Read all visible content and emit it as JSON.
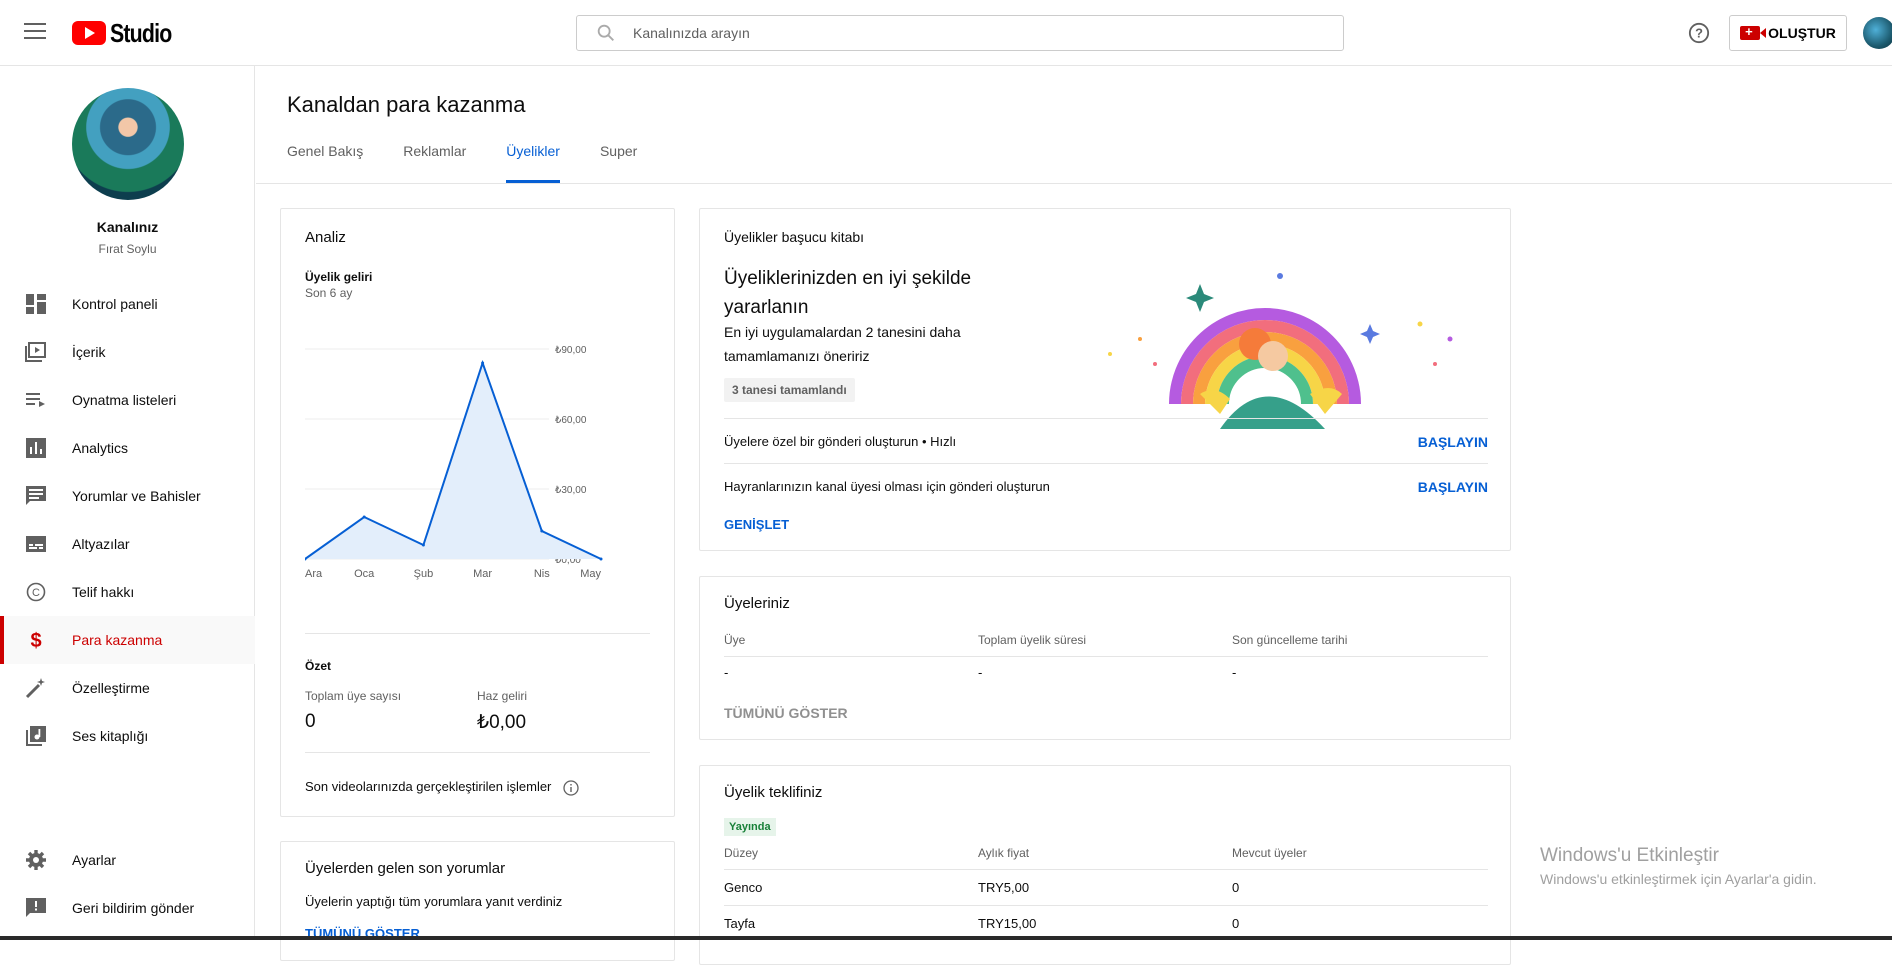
{
  "header": {
    "logo_text": "Studio",
    "search_placeholder": "Kanalınızda arayın",
    "create_label": "OLUŞTUR"
  },
  "sidebar": {
    "channel_title": "Kanalınız",
    "channel_name": "Fırat Soylu",
    "items": [
      {
        "label": "Kontrol paneli",
        "icon": "dashboard-icon"
      },
      {
        "label": "İçerik",
        "icon": "content-icon"
      },
      {
        "label": "Oynatma listeleri",
        "icon": "playlist-icon"
      },
      {
        "label": "Analytics",
        "icon": "analytics-icon"
      },
      {
        "label": "Yorumlar ve Bahisler",
        "icon": "comments-icon"
      },
      {
        "label": "Altyazılar",
        "icon": "subtitles-icon"
      },
      {
        "label": "Telif hakkı",
        "icon": "copyright-icon"
      },
      {
        "label": "Para kazanma",
        "icon": "dollar-icon",
        "active": true
      },
      {
        "label": "Özelleştirme",
        "icon": "magic-wand-icon"
      },
      {
        "label": "Ses kitaplığı",
        "icon": "audio-library-icon"
      }
    ],
    "bottom_items": [
      {
        "label": "Ayarlar",
        "icon": "gear-icon"
      },
      {
        "label": "Geri bildirim gönder",
        "icon": "feedback-icon"
      }
    ]
  },
  "main": {
    "title": "Kanaldan para kazanma",
    "tabs": [
      {
        "label": "Genel Bakış"
      },
      {
        "label": "Reklamlar"
      },
      {
        "label": "Üyelikler",
        "active": true
      },
      {
        "label": "Super"
      }
    ]
  },
  "analiz": {
    "title": "Analiz",
    "metric_title": "Üyelik geliri",
    "metric_period": "Son 6 ay",
    "summary_title": "Özet",
    "total_members_label": "Toplam üye sayısı",
    "total_members_value": "0",
    "net_revenue_label": "Haz geliri",
    "net_revenue_value": "₺0,00",
    "recent_actions": "Son videolarınızda gerçekleştirilen işlemler"
  },
  "chart_data": {
    "type": "area",
    "categories": [
      "Ara",
      "Oca",
      "Şub",
      "Mar",
      "Nis",
      "May"
    ],
    "values": [
      0,
      18,
      6,
      84,
      12,
      0
    ],
    "y_ticks": [
      "₺90,00",
      "₺60,00",
      "₺30,00",
      "₺0,00"
    ],
    "ylim": [
      0,
      90
    ],
    "grid": true,
    "line_color": "#065fd4",
    "fill_color": "#e3eefb"
  },
  "playbook": {
    "title": "Üyelikler başucu kitabı",
    "headline": "Üyeliklerinizden en iyi şekilde yararlanın",
    "description": "En iyi uygulamalardan 2 tanesini daha tamamlamanızı öneririz",
    "chip": "3 tanesi tamamlandı",
    "rows": [
      {
        "text": "Üyelere özel bir gönderi oluşturun • Hızlı",
        "action": "BAŞLAYIN"
      },
      {
        "text": "Hayranlarınızın kanal üyesi olması için gönderi oluşturun",
        "action": "BAŞLAYIN"
      }
    ],
    "expand": "GENİŞLET"
  },
  "members": {
    "title": "Üyeleriniz",
    "headers": [
      "Üye",
      "Toplam üyelik süresi",
      "Son güncelleme tarihi"
    ],
    "row": [
      "-",
      "-",
      "-"
    ],
    "show_all": "TÜMÜNÜ GÖSTER"
  },
  "offer": {
    "title": "Üyelik teklifiniz",
    "status": "Yayında",
    "headers": [
      "Düzey",
      "Aylık fiyat",
      "Mevcut üyeler"
    ],
    "rows": [
      [
        "Genco",
        "TRY5,00",
        "0"
      ],
      [
        "Tayfa",
        "TRY15,00",
        "0"
      ]
    ]
  },
  "comments": {
    "title": "Üyelerden gelen son yorumlar",
    "text": "Üyelerin yaptığı tüm yorumlara yanıt verdiniz",
    "show_all": "TÜMÜNÜ GÖSTER"
  },
  "windows": {
    "line1": "Windows'u Etkinleştir",
    "line2": "Windows'u etkinleştirmek için Ayarlar'a gidin."
  }
}
